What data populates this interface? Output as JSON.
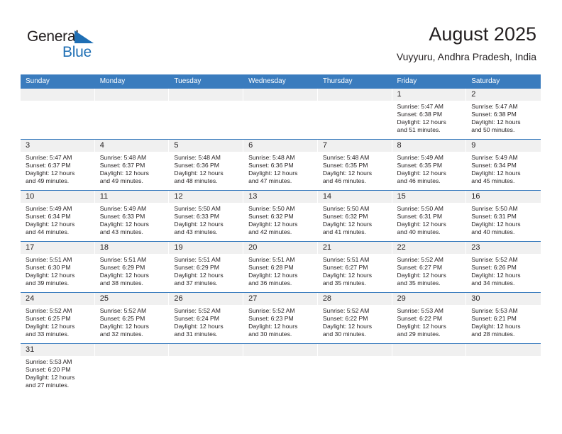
{
  "brand": {
    "name_primary": "General",
    "name_secondary": "Blue",
    "flag_icon": "triangle-flag-icon",
    "primary_color": "#231f20",
    "secondary_color": "#1f6fb4"
  },
  "header": {
    "title": "August 2025",
    "subtitle": "Vuyyuru, Andhra Pradesh, India"
  },
  "theme": {
    "header_bg": "#3a7cbe",
    "header_text": "#ffffff",
    "daynum_bg": "#f0f0f0",
    "grid_line": "#3a7cbe",
    "body_text": "#231f20"
  },
  "calendar": {
    "weekday_headers": [
      "Sunday",
      "Monday",
      "Tuesday",
      "Wednesday",
      "Thursday",
      "Friday",
      "Saturday"
    ],
    "weeks": [
      [
        {
          "day": "",
          "sunrise": "",
          "sunset": "",
          "daylight_line1": "",
          "daylight_line2": ""
        },
        {
          "day": "",
          "sunrise": "",
          "sunset": "",
          "daylight_line1": "",
          "daylight_line2": ""
        },
        {
          "day": "",
          "sunrise": "",
          "sunset": "",
          "daylight_line1": "",
          "daylight_line2": ""
        },
        {
          "day": "",
          "sunrise": "",
          "sunset": "",
          "daylight_line1": "",
          "daylight_line2": ""
        },
        {
          "day": "",
          "sunrise": "",
          "sunset": "",
          "daylight_line1": "",
          "daylight_line2": ""
        },
        {
          "day": "1",
          "sunrise": "Sunrise: 5:47 AM",
          "sunset": "Sunset: 6:38 PM",
          "daylight_line1": "Daylight: 12 hours",
          "daylight_line2": "and 51 minutes."
        },
        {
          "day": "2",
          "sunrise": "Sunrise: 5:47 AM",
          "sunset": "Sunset: 6:38 PM",
          "daylight_line1": "Daylight: 12 hours",
          "daylight_line2": "and 50 minutes."
        }
      ],
      [
        {
          "day": "3",
          "sunrise": "Sunrise: 5:47 AM",
          "sunset": "Sunset: 6:37 PM",
          "daylight_line1": "Daylight: 12 hours",
          "daylight_line2": "and 49 minutes."
        },
        {
          "day": "4",
          "sunrise": "Sunrise: 5:48 AM",
          "sunset": "Sunset: 6:37 PM",
          "daylight_line1": "Daylight: 12 hours",
          "daylight_line2": "and 49 minutes."
        },
        {
          "day": "5",
          "sunrise": "Sunrise: 5:48 AM",
          "sunset": "Sunset: 6:36 PM",
          "daylight_line1": "Daylight: 12 hours",
          "daylight_line2": "and 48 minutes."
        },
        {
          "day": "6",
          "sunrise": "Sunrise: 5:48 AM",
          "sunset": "Sunset: 6:36 PM",
          "daylight_line1": "Daylight: 12 hours",
          "daylight_line2": "and 47 minutes."
        },
        {
          "day": "7",
          "sunrise": "Sunrise: 5:48 AM",
          "sunset": "Sunset: 6:35 PM",
          "daylight_line1": "Daylight: 12 hours",
          "daylight_line2": "and 46 minutes."
        },
        {
          "day": "8",
          "sunrise": "Sunrise: 5:49 AM",
          "sunset": "Sunset: 6:35 PM",
          "daylight_line1": "Daylight: 12 hours",
          "daylight_line2": "and 46 minutes."
        },
        {
          "day": "9",
          "sunrise": "Sunrise: 5:49 AM",
          "sunset": "Sunset: 6:34 PM",
          "daylight_line1": "Daylight: 12 hours",
          "daylight_line2": "and 45 minutes."
        }
      ],
      [
        {
          "day": "10",
          "sunrise": "Sunrise: 5:49 AM",
          "sunset": "Sunset: 6:34 PM",
          "daylight_line1": "Daylight: 12 hours",
          "daylight_line2": "and 44 minutes."
        },
        {
          "day": "11",
          "sunrise": "Sunrise: 5:49 AM",
          "sunset": "Sunset: 6:33 PM",
          "daylight_line1": "Daylight: 12 hours",
          "daylight_line2": "and 43 minutes."
        },
        {
          "day": "12",
          "sunrise": "Sunrise: 5:50 AM",
          "sunset": "Sunset: 6:33 PM",
          "daylight_line1": "Daylight: 12 hours",
          "daylight_line2": "and 43 minutes."
        },
        {
          "day": "13",
          "sunrise": "Sunrise: 5:50 AM",
          "sunset": "Sunset: 6:32 PM",
          "daylight_line1": "Daylight: 12 hours",
          "daylight_line2": "and 42 minutes."
        },
        {
          "day": "14",
          "sunrise": "Sunrise: 5:50 AM",
          "sunset": "Sunset: 6:32 PM",
          "daylight_line1": "Daylight: 12 hours",
          "daylight_line2": "and 41 minutes."
        },
        {
          "day": "15",
          "sunrise": "Sunrise: 5:50 AM",
          "sunset": "Sunset: 6:31 PM",
          "daylight_line1": "Daylight: 12 hours",
          "daylight_line2": "and 40 minutes."
        },
        {
          "day": "16",
          "sunrise": "Sunrise: 5:50 AM",
          "sunset": "Sunset: 6:31 PM",
          "daylight_line1": "Daylight: 12 hours",
          "daylight_line2": "and 40 minutes."
        }
      ],
      [
        {
          "day": "17",
          "sunrise": "Sunrise: 5:51 AM",
          "sunset": "Sunset: 6:30 PM",
          "daylight_line1": "Daylight: 12 hours",
          "daylight_line2": "and 39 minutes."
        },
        {
          "day": "18",
          "sunrise": "Sunrise: 5:51 AM",
          "sunset": "Sunset: 6:29 PM",
          "daylight_line1": "Daylight: 12 hours",
          "daylight_line2": "and 38 minutes."
        },
        {
          "day": "19",
          "sunrise": "Sunrise: 5:51 AM",
          "sunset": "Sunset: 6:29 PM",
          "daylight_line1": "Daylight: 12 hours",
          "daylight_line2": "and 37 minutes."
        },
        {
          "day": "20",
          "sunrise": "Sunrise: 5:51 AM",
          "sunset": "Sunset: 6:28 PM",
          "daylight_line1": "Daylight: 12 hours",
          "daylight_line2": "and 36 minutes."
        },
        {
          "day": "21",
          "sunrise": "Sunrise: 5:51 AM",
          "sunset": "Sunset: 6:27 PM",
          "daylight_line1": "Daylight: 12 hours",
          "daylight_line2": "and 35 minutes."
        },
        {
          "day": "22",
          "sunrise": "Sunrise: 5:52 AM",
          "sunset": "Sunset: 6:27 PM",
          "daylight_line1": "Daylight: 12 hours",
          "daylight_line2": "and 35 minutes."
        },
        {
          "day": "23",
          "sunrise": "Sunrise: 5:52 AM",
          "sunset": "Sunset: 6:26 PM",
          "daylight_line1": "Daylight: 12 hours",
          "daylight_line2": "and 34 minutes."
        }
      ],
      [
        {
          "day": "24",
          "sunrise": "Sunrise: 5:52 AM",
          "sunset": "Sunset: 6:25 PM",
          "daylight_line1": "Daylight: 12 hours",
          "daylight_line2": "and 33 minutes."
        },
        {
          "day": "25",
          "sunrise": "Sunrise: 5:52 AM",
          "sunset": "Sunset: 6:25 PM",
          "daylight_line1": "Daylight: 12 hours",
          "daylight_line2": "and 32 minutes."
        },
        {
          "day": "26",
          "sunrise": "Sunrise: 5:52 AM",
          "sunset": "Sunset: 6:24 PM",
          "daylight_line1": "Daylight: 12 hours",
          "daylight_line2": "and 31 minutes."
        },
        {
          "day": "27",
          "sunrise": "Sunrise: 5:52 AM",
          "sunset": "Sunset: 6:23 PM",
          "daylight_line1": "Daylight: 12 hours",
          "daylight_line2": "and 30 minutes."
        },
        {
          "day": "28",
          "sunrise": "Sunrise: 5:52 AM",
          "sunset": "Sunset: 6:22 PM",
          "daylight_line1": "Daylight: 12 hours",
          "daylight_line2": "and 30 minutes."
        },
        {
          "day": "29",
          "sunrise": "Sunrise: 5:53 AM",
          "sunset": "Sunset: 6:22 PM",
          "daylight_line1": "Daylight: 12 hours",
          "daylight_line2": "and 29 minutes."
        },
        {
          "day": "30",
          "sunrise": "Sunrise: 5:53 AM",
          "sunset": "Sunset: 6:21 PM",
          "daylight_line1": "Daylight: 12 hours",
          "daylight_line2": "and 28 minutes."
        }
      ],
      [
        {
          "day": "31",
          "sunrise": "Sunrise: 5:53 AM",
          "sunset": "Sunset: 6:20 PM",
          "daylight_line1": "Daylight: 12 hours",
          "daylight_line2": "and 27 minutes."
        },
        {
          "day": "",
          "sunrise": "",
          "sunset": "",
          "daylight_line1": "",
          "daylight_line2": ""
        },
        {
          "day": "",
          "sunrise": "",
          "sunset": "",
          "daylight_line1": "",
          "daylight_line2": ""
        },
        {
          "day": "",
          "sunrise": "",
          "sunset": "",
          "daylight_line1": "",
          "daylight_line2": ""
        },
        {
          "day": "",
          "sunrise": "",
          "sunset": "",
          "daylight_line1": "",
          "daylight_line2": ""
        },
        {
          "day": "",
          "sunrise": "",
          "sunset": "",
          "daylight_line1": "",
          "daylight_line2": ""
        },
        {
          "day": "",
          "sunrise": "",
          "sunset": "",
          "daylight_line1": "",
          "daylight_line2": ""
        }
      ]
    ]
  }
}
